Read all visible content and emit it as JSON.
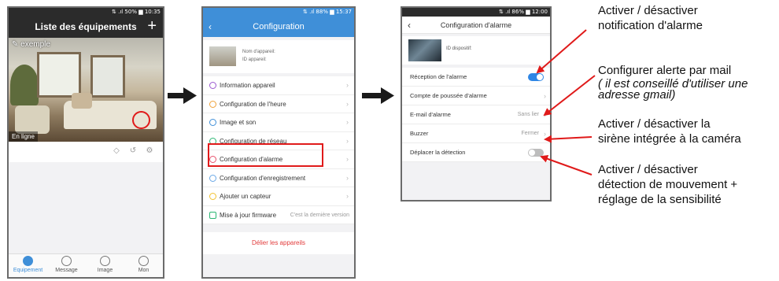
{
  "phone1": {
    "status": "⇅ .ıl 50% ▆ 10:35",
    "title": "Liste des équipements",
    "add_icon": "plus-icon",
    "camera_name": "exemple",
    "online_label": "En ligne",
    "tabs": [
      {
        "label": "Equipement",
        "icon": "device-icon",
        "active": true
      },
      {
        "label": "Message",
        "icon": "message-icon",
        "active": false
      },
      {
        "label": "Image",
        "icon": "image-icon",
        "active": false
      },
      {
        "label": "Mon",
        "icon": "person-icon",
        "active": false
      }
    ]
  },
  "phone2": {
    "status": "⇅ .ıl 88% ▆ 15:37",
    "title": "Configuration",
    "device_name": "Nom d'appareil:",
    "device_id": "ID appareil:",
    "menu": [
      {
        "label": "Information appareil",
        "icon": "info-icon",
        "extra": ""
      },
      {
        "label": "Configuration de l'heure",
        "icon": "clock-icon",
        "extra": ""
      },
      {
        "label": "Image et son",
        "icon": "image-sound-icon",
        "extra": ""
      },
      {
        "label": "Configuration de réseau",
        "icon": "wifi-icon",
        "extra": ""
      },
      {
        "label": "Configuration d'alarme",
        "icon": "bell-icon",
        "extra": ""
      },
      {
        "label": "Configuration d'enregistrement",
        "icon": "record-icon",
        "extra": ""
      },
      {
        "label": "Ajouter un capteur",
        "icon": "sensor-icon",
        "extra": ""
      },
      {
        "label": "Mise à jour firmware",
        "icon": "firmware-icon",
        "extra": "C'est la dernière version"
      }
    ],
    "unlink": "Délier les appareils"
  },
  "phone3": {
    "status": "⇅ .ıl 86% ▆ 12:00",
    "title": "Configuration d'alarme",
    "device_id": "ID dispositif:",
    "rows": [
      {
        "label": "Réception de l'alarme",
        "value": "",
        "toggle": "on"
      },
      {
        "label": "Compte de poussée d'alarme",
        "value": "",
        "toggle": ""
      },
      {
        "label": "E-mail d'alarme",
        "value": "Sans lier",
        "toggle": ""
      },
      {
        "label": "Buzzer",
        "value": "Fermer",
        "toggle": ""
      },
      {
        "label": "Déplacer la détection",
        "value": "",
        "toggle": "off"
      }
    ]
  },
  "annotations": {
    "note1_line1": "Activer / désactiver",
    "note1_line2": "notification d'alarme",
    "note2_line1": "Configurer alerte par mail",
    "note2_line2": "( il est conseillé d'utiliser une",
    "note2_line3": "adresse gmail)",
    "note3_line1": "Activer / désactiver la",
    "note3_line2": "sirène intégrée à la caméra",
    "note4_line1": "Activer / désactiver",
    "note4_line2": "détection de mouvement +",
    "note4_line3": "réglage de la sensibilité"
  },
  "colors": {
    "accent_blue": "#3f8fd8",
    "highlight_red": "#e01a1a",
    "toggle_on": "#2f86e5"
  }
}
